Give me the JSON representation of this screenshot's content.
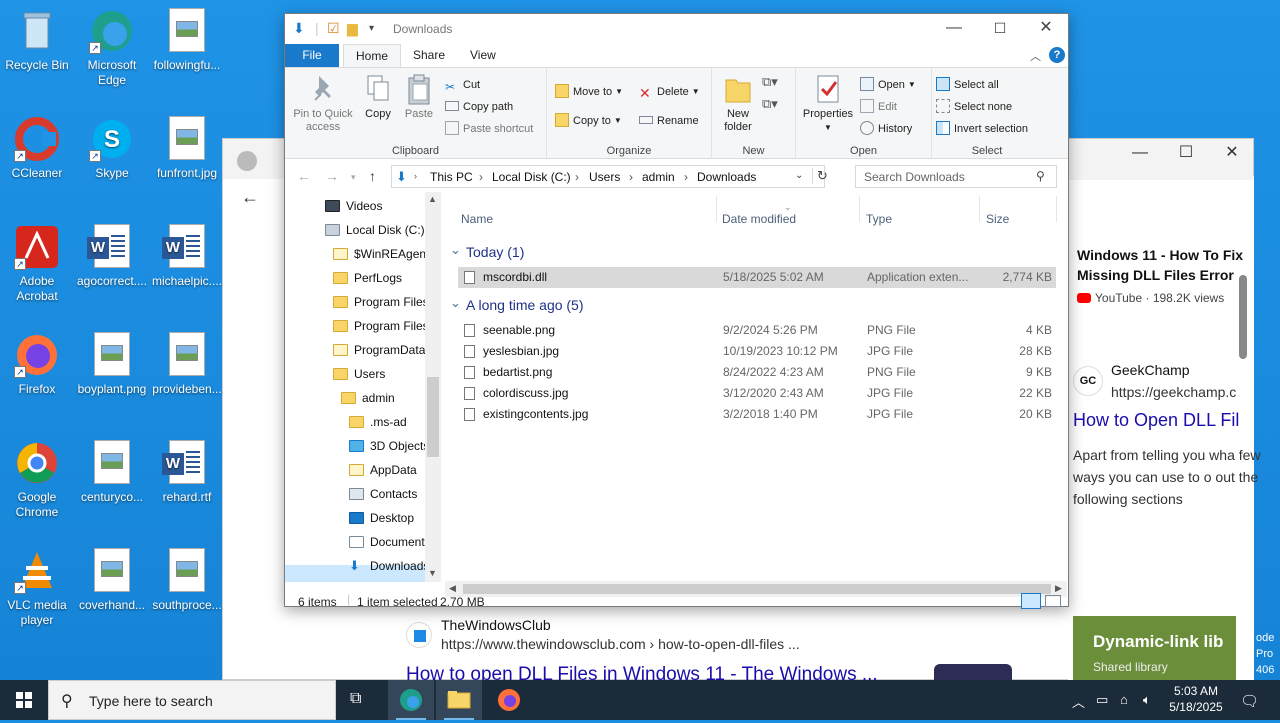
{
  "desktop": {
    "icons": [
      {
        "label": "Recycle Bin"
      },
      {
        "label": "Microsoft Edge"
      },
      {
        "label": "followingfu..."
      },
      {
        "label": "CCleaner"
      },
      {
        "label": "Skype"
      },
      {
        "label": "funfront.jpg"
      },
      {
        "label": "Adobe Acrobat"
      },
      {
        "label": "agocorrect...."
      },
      {
        "label": "michaelpic...."
      },
      {
        "label": "Firefox"
      },
      {
        "label": "boyplant.png"
      },
      {
        "label": "provideben..."
      },
      {
        "label": "Google Chrome"
      },
      {
        "label": "centuryco..."
      },
      {
        "label": "rehard.rtf"
      },
      {
        "label": "VLC media player"
      },
      {
        "label": "coverhand..."
      },
      {
        "label": "southproce..."
      }
    ]
  },
  "browser": {
    "yt_title": "Windows 11 - How To Fix Missing DLL Files Error",
    "yt_meta": "YouTube · 198.2K views",
    "gc_badge": "GC",
    "gc_name": "GeekChamp",
    "gc_url": "https://geekchamp.c",
    "gc_link": "How to Open DLL Fil",
    "gc_text": "Apart from telling you wha few ways you can use to o out the following sections",
    "twc_name": "TheWindowsClub",
    "twc_url": "https://www.thewindowsclub.com › how-to-open-dll-files ...",
    "twc_link": "How to open DLL Files in Windows 11 - The Windows ...",
    "card_title": "Dynamic-link lib",
    "card_sub": "Shared library",
    "edge_text": "ode Pro 406"
  },
  "explorer": {
    "title": "Downloads",
    "tabs": {
      "file": "File",
      "home": "Home",
      "share": "Share",
      "view": "View"
    },
    "ribbon": {
      "clipboard": {
        "label": "Clipboard",
        "pin": "Pin to Quick access",
        "copy": "Copy",
        "paste": "Paste",
        "cut": "Cut",
        "copy_path": "Copy path",
        "paste_shortcut": "Paste shortcut"
      },
      "organize": {
        "label": "Organize",
        "move_to": "Move to",
        "copy_to": "Copy to",
        "delete": "Delete",
        "rename": "Rename"
      },
      "new": {
        "label": "New",
        "new_folder": "New folder"
      },
      "open": {
        "label": "Open",
        "properties": "Properties",
        "open": "Open",
        "edit": "Edit",
        "history": "History"
      },
      "select": {
        "label": "Select",
        "select_all": "Select all",
        "select_none": "Select none",
        "invert": "Invert selection"
      }
    },
    "breadcrumb": [
      "This PC",
      "Local Disk (C:)",
      "Users",
      "admin",
      "Downloads"
    ],
    "search_placeholder": "Search Downloads",
    "nav": [
      "Videos",
      "Local Disk (C:)",
      "$WinREAgent",
      "PerfLogs",
      "Program Files",
      "Program Files",
      "ProgramData",
      "Users",
      "admin",
      ".ms-ad",
      "3D Objects",
      "AppData",
      "Contacts",
      "Desktop",
      "Documents",
      "Downloads"
    ],
    "columns": {
      "name": "Name",
      "date": "Date modified",
      "type": "Type",
      "size": "Size"
    },
    "groups": [
      {
        "title": "Today (1)",
        "files": [
          {
            "name": "mscordbi.dll",
            "date": "5/18/2025 5:02 AM",
            "type": "Application exten...",
            "size": "2,774 KB"
          }
        ]
      },
      {
        "title": "A long time ago (5)",
        "files": [
          {
            "name": "seenable.png",
            "date": "9/2/2024 5:26 PM",
            "type": "PNG File",
            "size": "4 KB"
          },
          {
            "name": "yeslesbian.jpg",
            "date": "10/19/2023 10:12 PM",
            "type": "JPG File",
            "size": "28 KB"
          },
          {
            "name": "bedartist.png",
            "date": "8/24/2022 4:23 AM",
            "type": "PNG File",
            "size": "9 KB"
          },
          {
            "name": "colordiscuss.jpg",
            "date": "3/12/2020 2:43 AM",
            "type": "JPG File",
            "size": "22 KB"
          },
          {
            "name": "existingcontents.jpg",
            "date": "3/2/2018 1:40 PM",
            "type": "JPG File",
            "size": "20 KB"
          }
        ]
      }
    ],
    "status": {
      "count": "6 items",
      "selected": "1 item selected",
      "size": "2.70 MB"
    }
  },
  "taskbar": {
    "search_placeholder": "Type here to search",
    "time": "5:03 AM",
    "date": "5/18/2025"
  }
}
